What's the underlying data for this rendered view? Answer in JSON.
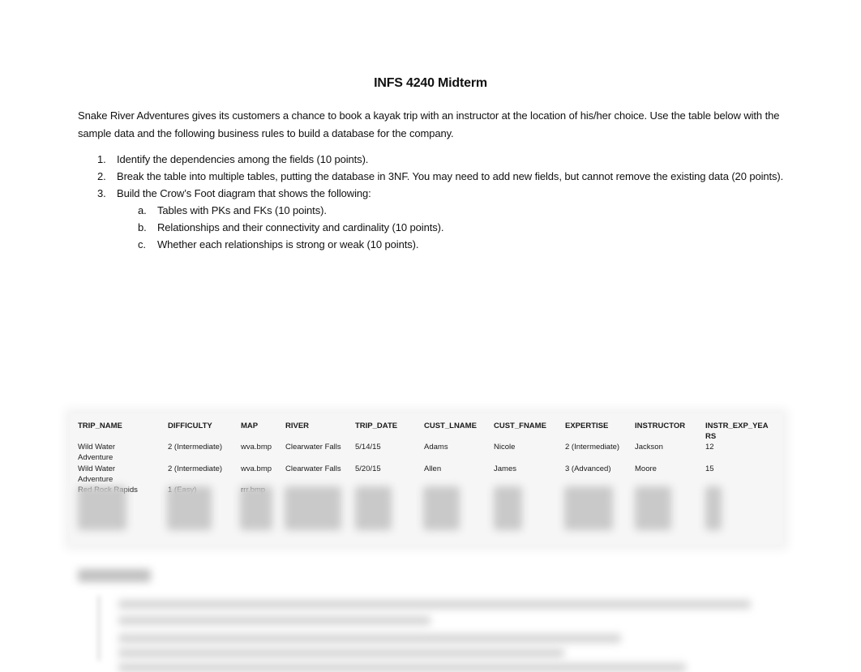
{
  "document": {
    "title": "INFS 4240 Midterm",
    "intro": "Snake River Adventures gives its customers a chance to book a kayak trip with an instructor at the location of his/her choice. Use the table below with the sample data and the following business rules to build a database for the company.",
    "tasks": [
      {
        "num": "1.",
        "text": "Identify the dependencies among the fields (10 points)."
      },
      {
        "num": "2.",
        "text": "Break the table into multiple tables, putting the database in 3NF. You may need to add new fields, but cannot remove the existing data (20 points)."
      },
      {
        "num": "3.",
        "text": "Build the Crow’s Foot diagram that shows the following:"
      }
    ],
    "subtasks": [
      {
        "num": "a.",
        "text": "Tables with PKs and FKs (10 points)."
      },
      {
        "num": "b.",
        "text": "Relationships and their connectivity and cardinality (10 points)."
      },
      {
        "num": "c.",
        "text": "Whether each relationships is strong or weak (10 points)."
      }
    ]
  },
  "table": {
    "headers": [
      "TRIP_NAME",
      "DIFFICULTY",
      "MAP",
      "RIVER",
      "TRIP_DATE",
      "CUST_LNAME",
      "CUST_FNAME",
      "EXPERTISE",
      "INSTRUCTOR",
      "INSTR_EXP_YEARS"
    ],
    "rows": [
      [
        "Wild Water Adventure",
        "2 (Intermediate)",
        "wva.bmp",
        "Clearwater Falls",
        "5/14/15",
        "Adams",
        "Nicole",
        "2 (Intermediate)",
        "Jackson",
        "12"
      ],
      [
        "Wild Water Adventure",
        "2 (Intermediate)",
        "wva.bmp",
        "Clearwater Falls",
        "5/20/15",
        "Allen",
        "James",
        "3 (Advanced)",
        "Moore",
        "15"
      ],
      [
        "Red Rock Rapids",
        "1 (Easy)",
        "rrr.bmp",
        "",
        "",
        "",
        "",
        "",
        "",
        ""
      ]
    ]
  }
}
